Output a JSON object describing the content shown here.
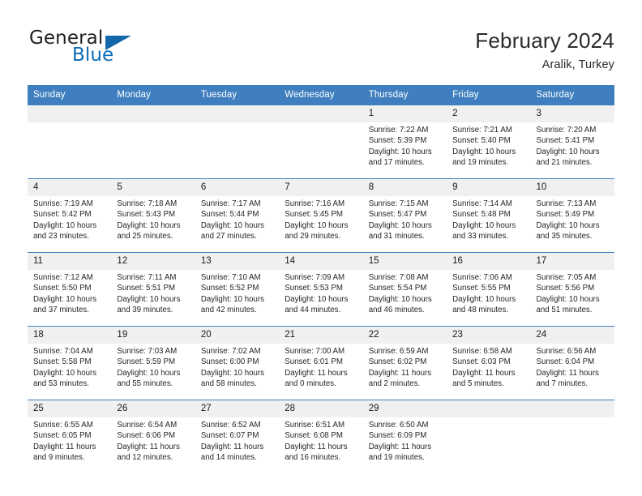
{
  "brand": {
    "name_part1": "General",
    "name_part2": "Blue",
    "flag_icon": "blue-triangle-flag",
    "accent_color": "#1368ac"
  },
  "header": {
    "title": "February 2024",
    "subtitle": "Aralik, Turkey"
  },
  "theme": {
    "header_row_bg": "#3f7fbf",
    "daynum_bg": "#f0f0f0",
    "border_color": "#3f7fbf",
    "text_color": "#262626"
  },
  "weekdays": [
    "Sunday",
    "Monday",
    "Tuesday",
    "Wednesday",
    "Thursday",
    "Friday",
    "Saturday"
  ],
  "labels": {
    "sunrise_prefix": "Sunrise:",
    "sunset_prefix": "Sunset:",
    "daylight_prefix": "Daylight:"
  },
  "weeks": [
    [
      {
        "day": "",
        "empty": true
      },
      {
        "day": "",
        "empty": true
      },
      {
        "day": "",
        "empty": true
      },
      {
        "day": "",
        "empty": true
      },
      {
        "day": "1",
        "sunrise": "Sunrise: 7:22 AM",
        "sunset": "Sunset: 5:39 PM",
        "daylight_l1": "Daylight: 10 hours",
        "daylight_l2": "and 17 minutes."
      },
      {
        "day": "2",
        "sunrise": "Sunrise: 7:21 AM",
        "sunset": "Sunset: 5:40 PM",
        "daylight_l1": "Daylight: 10 hours",
        "daylight_l2": "and 19 minutes."
      },
      {
        "day": "3",
        "sunrise": "Sunrise: 7:20 AM",
        "sunset": "Sunset: 5:41 PM",
        "daylight_l1": "Daylight: 10 hours",
        "daylight_l2": "and 21 minutes."
      }
    ],
    [
      {
        "day": "4",
        "sunrise": "Sunrise: 7:19 AM",
        "sunset": "Sunset: 5:42 PM",
        "daylight_l1": "Daylight: 10 hours",
        "daylight_l2": "and 23 minutes."
      },
      {
        "day": "5",
        "sunrise": "Sunrise: 7:18 AM",
        "sunset": "Sunset: 5:43 PM",
        "daylight_l1": "Daylight: 10 hours",
        "daylight_l2": "and 25 minutes."
      },
      {
        "day": "6",
        "sunrise": "Sunrise: 7:17 AM",
        "sunset": "Sunset: 5:44 PM",
        "daylight_l1": "Daylight: 10 hours",
        "daylight_l2": "and 27 minutes."
      },
      {
        "day": "7",
        "sunrise": "Sunrise: 7:16 AM",
        "sunset": "Sunset: 5:45 PM",
        "daylight_l1": "Daylight: 10 hours",
        "daylight_l2": "and 29 minutes."
      },
      {
        "day": "8",
        "sunrise": "Sunrise: 7:15 AM",
        "sunset": "Sunset: 5:47 PM",
        "daylight_l1": "Daylight: 10 hours",
        "daylight_l2": "and 31 minutes."
      },
      {
        "day": "9",
        "sunrise": "Sunrise: 7:14 AM",
        "sunset": "Sunset: 5:48 PM",
        "daylight_l1": "Daylight: 10 hours",
        "daylight_l2": "and 33 minutes."
      },
      {
        "day": "10",
        "sunrise": "Sunrise: 7:13 AM",
        "sunset": "Sunset: 5:49 PM",
        "daylight_l1": "Daylight: 10 hours",
        "daylight_l2": "and 35 minutes."
      }
    ],
    [
      {
        "day": "11",
        "sunrise": "Sunrise: 7:12 AM",
        "sunset": "Sunset: 5:50 PM",
        "daylight_l1": "Daylight: 10 hours",
        "daylight_l2": "and 37 minutes."
      },
      {
        "day": "12",
        "sunrise": "Sunrise: 7:11 AM",
        "sunset": "Sunset: 5:51 PM",
        "daylight_l1": "Daylight: 10 hours",
        "daylight_l2": "and 39 minutes."
      },
      {
        "day": "13",
        "sunrise": "Sunrise: 7:10 AM",
        "sunset": "Sunset: 5:52 PM",
        "daylight_l1": "Daylight: 10 hours",
        "daylight_l2": "and 42 minutes."
      },
      {
        "day": "14",
        "sunrise": "Sunrise: 7:09 AM",
        "sunset": "Sunset: 5:53 PM",
        "daylight_l1": "Daylight: 10 hours",
        "daylight_l2": "and 44 minutes."
      },
      {
        "day": "15",
        "sunrise": "Sunrise: 7:08 AM",
        "sunset": "Sunset: 5:54 PM",
        "daylight_l1": "Daylight: 10 hours",
        "daylight_l2": "and 46 minutes."
      },
      {
        "day": "16",
        "sunrise": "Sunrise: 7:06 AM",
        "sunset": "Sunset: 5:55 PM",
        "daylight_l1": "Daylight: 10 hours",
        "daylight_l2": "and 48 minutes."
      },
      {
        "day": "17",
        "sunrise": "Sunrise: 7:05 AM",
        "sunset": "Sunset: 5:56 PM",
        "daylight_l1": "Daylight: 10 hours",
        "daylight_l2": "and 51 minutes."
      }
    ],
    [
      {
        "day": "18",
        "sunrise": "Sunrise: 7:04 AM",
        "sunset": "Sunset: 5:58 PM",
        "daylight_l1": "Daylight: 10 hours",
        "daylight_l2": "and 53 minutes."
      },
      {
        "day": "19",
        "sunrise": "Sunrise: 7:03 AM",
        "sunset": "Sunset: 5:59 PM",
        "daylight_l1": "Daylight: 10 hours",
        "daylight_l2": "and 55 minutes."
      },
      {
        "day": "20",
        "sunrise": "Sunrise: 7:02 AM",
        "sunset": "Sunset: 6:00 PM",
        "daylight_l1": "Daylight: 10 hours",
        "daylight_l2": "and 58 minutes."
      },
      {
        "day": "21",
        "sunrise": "Sunrise: 7:00 AM",
        "sunset": "Sunset: 6:01 PM",
        "daylight_l1": "Daylight: 11 hours",
        "daylight_l2": "and 0 minutes."
      },
      {
        "day": "22",
        "sunrise": "Sunrise: 6:59 AM",
        "sunset": "Sunset: 6:02 PM",
        "daylight_l1": "Daylight: 11 hours",
        "daylight_l2": "and 2 minutes."
      },
      {
        "day": "23",
        "sunrise": "Sunrise: 6:58 AM",
        "sunset": "Sunset: 6:03 PM",
        "daylight_l1": "Daylight: 11 hours",
        "daylight_l2": "and 5 minutes."
      },
      {
        "day": "24",
        "sunrise": "Sunrise: 6:56 AM",
        "sunset": "Sunset: 6:04 PM",
        "daylight_l1": "Daylight: 11 hours",
        "daylight_l2": "and 7 minutes."
      }
    ],
    [
      {
        "day": "25",
        "sunrise": "Sunrise: 6:55 AM",
        "sunset": "Sunset: 6:05 PM",
        "daylight_l1": "Daylight: 11 hours",
        "daylight_l2": "and 9 minutes."
      },
      {
        "day": "26",
        "sunrise": "Sunrise: 6:54 AM",
        "sunset": "Sunset: 6:06 PM",
        "daylight_l1": "Daylight: 11 hours",
        "daylight_l2": "and 12 minutes."
      },
      {
        "day": "27",
        "sunrise": "Sunrise: 6:52 AM",
        "sunset": "Sunset: 6:07 PM",
        "daylight_l1": "Daylight: 11 hours",
        "daylight_l2": "and 14 minutes."
      },
      {
        "day": "28",
        "sunrise": "Sunrise: 6:51 AM",
        "sunset": "Sunset: 6:08 PM",
        "daylight_l1": "Daylight: 11 hours",
        "daylight_l2": "and 16 minutes."
      },
      {
        "day": "29",
        "sunrise": "Sunrise: 6:50 AM",
        "sunset": "Sunset: 6:09 PM",
        "daylight_l1": "Daylight: 11 hours",
        "daylight_l2": "and 19 minutes."
      },
      {
        "day": "",
        "empty": true
      },
      {
        "day": "",
        "empty": true
      }
    ]
  ]
}
